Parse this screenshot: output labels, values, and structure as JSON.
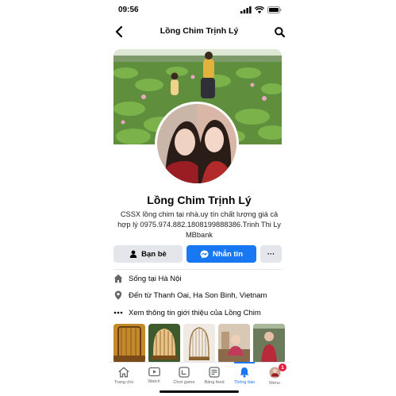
{
  "status_bar": {
    "time": "09:56"
  },
  "header": {
    "title": "Lồng Chim Trịnh Lý"
  },
  "profile": {
    "name": "Lồng Chim Trịnh Lý",
    "bio": "CSSX lồng chim tại nhà.uy tín chất lượng giá cả hợp lý 0975.974.882.1808199888386.Trinh Thi Ly MBbank"
  },
  "actions": {
    "friends_label": "Bạn bè",
    "message_label": "Nhắn tin",
    "more_label": "···"
  },
  "about": {
    "lives_in": "Sống tại Hà Nội",
    "from": "Đến từ Thanh Oai, Ha Son Binh, Vietnam",
    "see_more": "Xem thông tin giới thiệu của Lồng Chim"
  },
  "tabs": [
    {
      "label": "Trang chủ",
      "icon": "home-icon"
    },
    {
      "label": "Watch",
      "icon": "watch-icon"
    },
    {
      "label": "Chơi game",
      "icon": "gaming-icon"
    },
    {
      "label": "Bảng feed",
      "icon": "feeds-icon"
    },
    {
      "label": "Thông báo",
      "icon": "bell-icon",
      "active": true
    },
    {
      "label": "Menu",
      "icon": "menu-avatar-icon",
      "badge": "1"
    }
  ],
  "colors": {
    "accent": "#1877f2",
    "badge": "#e41e3f",
    "button_gray": "#e4e6eb"
  }
}
